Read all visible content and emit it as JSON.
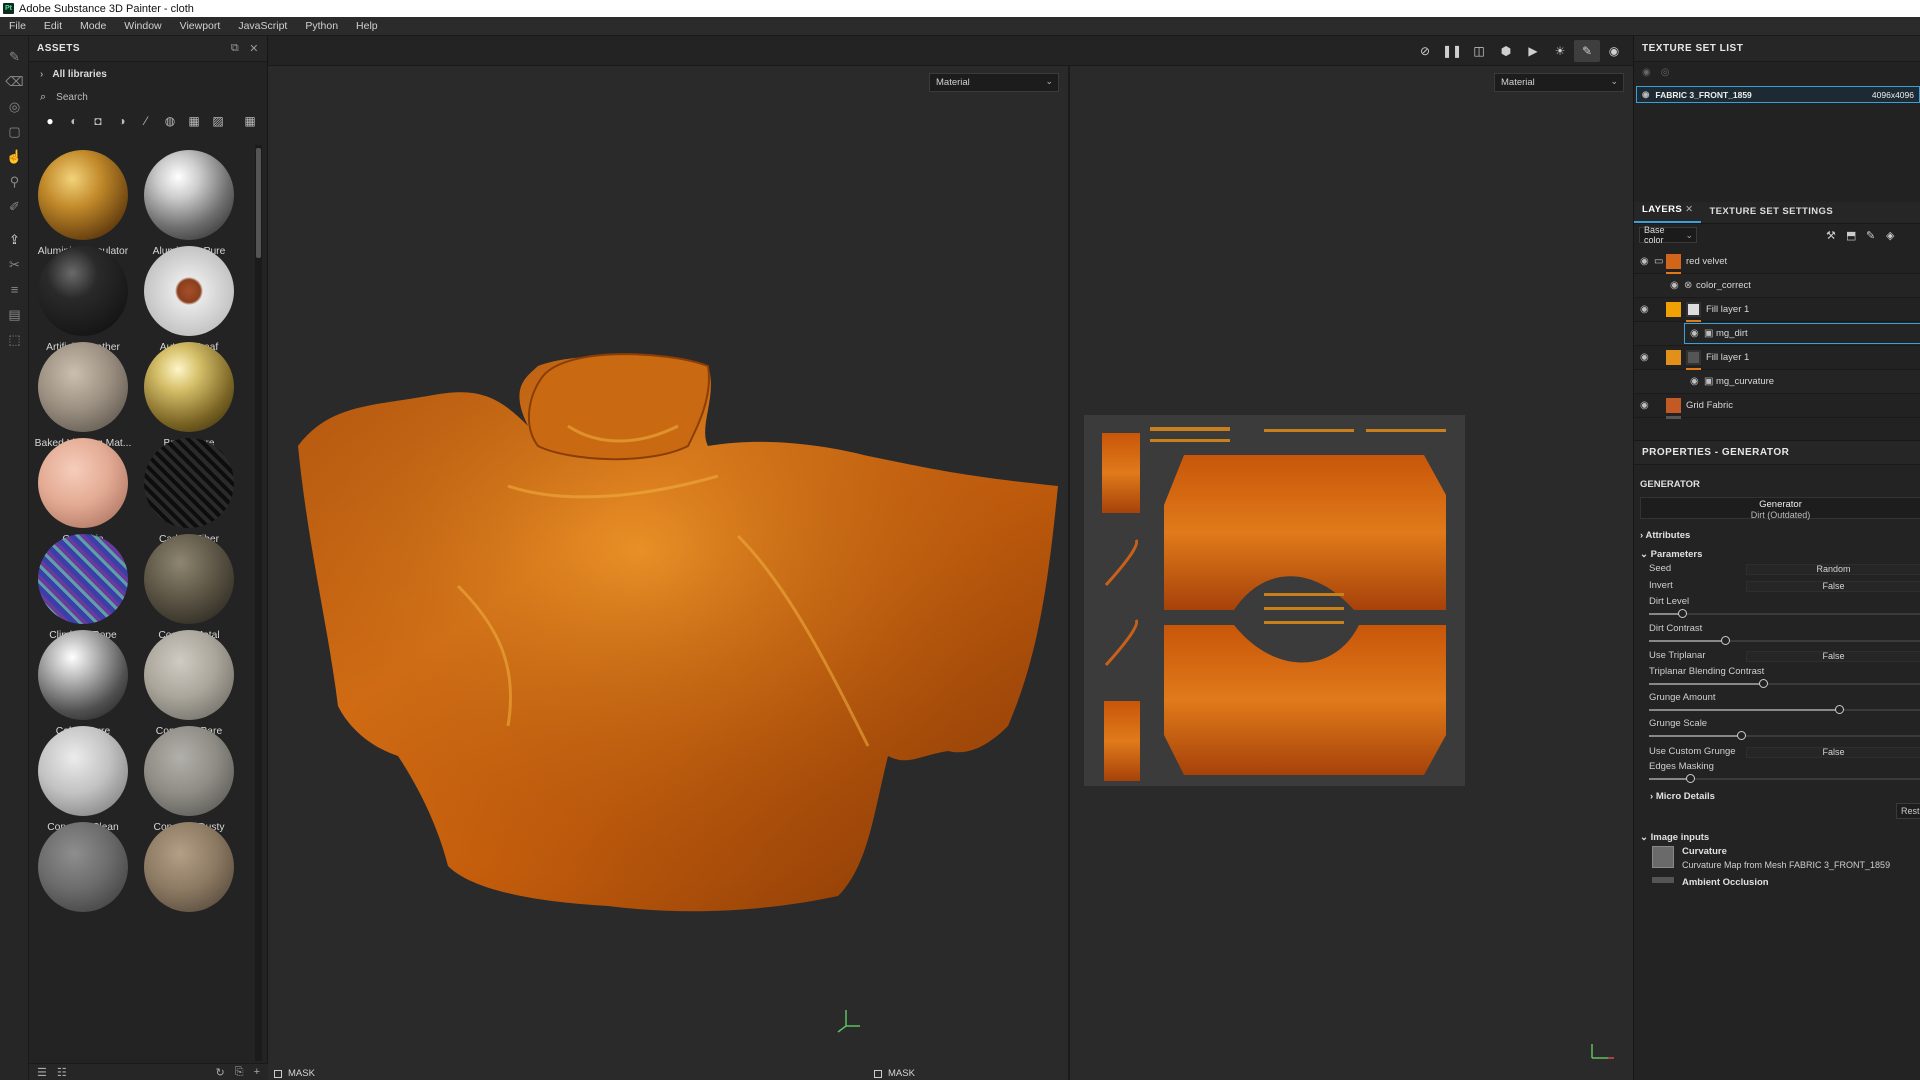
{
  "window": {
    "title": "Adobe Substance 3D Painter - cloth",
    "logo": "Pt"
  },
  "menu": [
    "File",
    "Edit",
    "Mode",
    "Window",
    "Viewport",
    "JavaScript",
    "Python",
    "Help"
  ],
  "tool_icons": [
    "paint-brush-icon",
    "eraser-icon",
    "projection-icon",
    "geometry-mask-icon",
    "smudge-icon",
    "clone-icon",
    "color-picker-icon",
    "bake-icon",
    "material-picker-icon",
    "polygon-fill-icon",
    "annotation-icon",
    "measure-icon"
  ],
  "assets": {
    "title": "ASSETS",
    "library": "All libraries",
    "search_placeholder": "Search",
    "items": [
      {
        "label": "Aluminium Insulator",
        "color": "#b8862a"
      },
      {
        "label": "Aluminium Pure",
        "color": "#d5d5d5"
      },
      {
        "label": "Artificial Leather",
        "color": "#1a1a1a"
      },
      {
        "label": "Autumn Leaf",
        "color": "#f1f1f1"
      },
      {
        "label": "Baked Lighting Mat...",
        "color": "#9c9082"
      },
      {
        "label": "Brass Pure",
        "color": "#c9b25a"
      },
      {
        "label": "Calf Skin",
        "color": "#e9b6a0"
      },
      {
        "label": "Carbon Fiber",
        "color": "#1c1c1c"
      },
      {
        "label": "Climbing Rope",
        "color": "#4b4b9e"
      },
      {
        "label": "Coated Metal",
        "color": "#5d5646"
      },
      {
        "label": "Cobalt Pure",
        "color": "#c7c7c7"
      },
      {
        "label": "Concrete Bare",
        "color": "#aaa69c"
      },
      {
        "label": "Concrete Clean",
        "color": "#c9c9c9"
      },
      {
        "label": "Concrete Dusty",
        "color": "#8f8d86"
      },
      {
        "label": "",
        "color": "#6c6c6c"
      },
      {
        "label": "",
        "color": "#8e7b64"
      }
    ]
  },
  "viewport": {
    "left_mode": "Material",
    "right_mode": "Material",
    "mask_label": "MASK",
    "toolbar_icons": [
      "hide-icon",
      "pause-icon",
      "split-view-icon",
      "display-icon",
      "camera-icon",
      "environment-icon",
      "paint-mode-icon",
      "screenshot-icon"
    ]
  },
  "texture_set_list": {
    "title": "TEXTURE SET LIST",
    "name": "FABRIC 3_FRONT_1859",
    "resolution": "4096x4096"
  },
  "layers": {
    "tab_layers": "LAYERS",
    "tab_settings": "TEXTURE SET SETTINGS",
    "channel": "Base color",
    "rows": [
      {
        "name": "red velvet",
        "type": "folder"
      },
      {
        "name": "color_correct",
        "type": "effect"
      },
      {
        "name": "Fill layer 1",
        "type": "fill"
      },
      {
        "name": "mg_dirt",
        "type": "mask"
      },
      {
        "name": "Fill layer 1",
        "type": "fill"
      },
      {
        "name": "mg_curvature",
        "type": "mask"
      },
      {
        "name": "Grid Fabric",
        "type": "material"
      }
    ]
  },
  "properties": {
    "title": "PROPERTIES - GENERATOR",
    "section": "GENERATOR",
    "generator_label": "Generator",
    "generator_value": "Dirt (Outdated)",
    "attributes": "Attributes",
    "parameters": "Parameters",
    "params": [
      {
        "label": "Seed",
        "value": "Random"
      },
      {
        "label": "Invert",
        "value": "False"
      },
      {
        "label": "Dirt Level",
        "slider": 0.12
      },
      {
        "label": "Dirt Contrast",
        "slider": 0.28
      },
      {
        "label": "Use Triplanar",
        "value": "False"
      },
      {
        "label": "Triplanar Blending Contrast",
        "slider": 0.42
      },
      {
        "label": "Grunge Amount",
        "slider": 0.7
      },
      {
        "label": "Grunge Scale",
        "slider": 0.34
      },
      {
        "label": "Use Custom Grunge",
        "value": "False"
      },
      {
        "label": "Edges Masking",
        "slider": 0.15
      }
    ],
    "micro_details": "Micro Details",
    "reset": "Rest",
    "image_inputs": "Image inputs",
    "input_name": "Curvature",
    "input_desc": "Curvature Map from Mesh FABRIC 3_FRONT_1859",
    "input2": "Ambient Occlusion"
  }
}
